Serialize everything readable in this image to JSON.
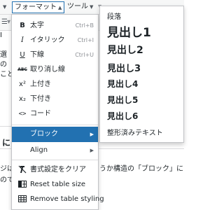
{
  "menubar": {
    "format_label": "フォーマット",
    "tools_label": "ツール"
  },
  "background": {
    "heading_fragment": "に",
    "bottom_line1_left": "ジは",
    "bottom_line1_right": "うか構造の「ブロック」に",
    "bottom_line2_left": "ので"
  },
  "format_menu": {
    "items": [
      {
        "icon": "B",
        "label": "太字",
        "shortcut": "Ctrl+B"
      },
      {
        "icon": "I",
        "label": "イタリック",
        "shortcut": "Ctrl+I"
      },
      {
        "icon": "U",
        "label": "下線",
        "shortcut": "Ctrl+U"
      },
      {
        "icon": "ABC",
        "label": "取り消し線"
      },
      {
        "icon": "x²",
        "label": "上付き"
      },
      {
        "icon": "x₂",
        "label": "下付き"
      },
      {
        "icon": "<>",
        "label": "コード"
      },
      {
        "label": "ブロック",
        "has_submenu": true,
        "active": true
      },
      {
        "label": "Align",
        "has_submenu": true
      },
      {
        "label": "書式設定をクリア"
      },
      {
        "label": "Reset table size"
      },
      {
        "label": "Remove table styling"
      }
    ]
  },
  "block_submenu": {
    "items": [
      {
        "label": "段落"
      },
      {
        "label": "見出し1"
      },
      {
        "label": "見出し2"
      },
      {
        "label": "見出し3"
      },
      {
        "label": "見出し4"
      },
      {
        "label": "見出し5"
      },
      {
        "label": "見出し6"
      },
      {
        "label": "整形済みテキスト"
      }
    ]
  },
  "colors": {
    "accent": "#2271b1",
    "menu_border": "#c3c4c7",
    "background": "#f6f7f7"
  }
}
